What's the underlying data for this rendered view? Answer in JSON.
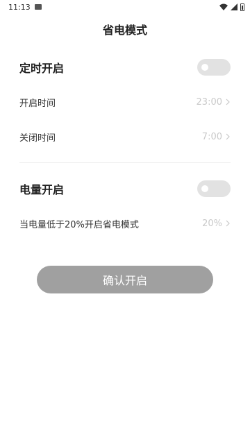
{
  "status_bar": {
    "time": "11:13",
    "icons": [
      "gallery-icon",
      "wifi-icon",
      "signal-icon",
      "battery-icon"
    ]
  },
  "header": {
    "title": "省电模式"
  },
  "timed_section": {
    "title": "定时开启",
    "toggle_on": false,
    "start_label": "开启时间",
    "start_value": "23:00",
    "end_label": "关闭时间",
    "end_value": "7:00"
  },
  "battery_section": {
    "title": "电量开启",
    "toggle_on": false,
    "threshold_label": "当电量低于20%开启省电模式",
    "threshold_value": "20%"
  },
  "actions": {
    "confirm_label": "确认开启"
  },
  "colors": {
    "toggle_off": "#e2e2e2",
    "button_disabled": "#a0a0a0",
    "value_text": "#c9c9c9"
  }
}
